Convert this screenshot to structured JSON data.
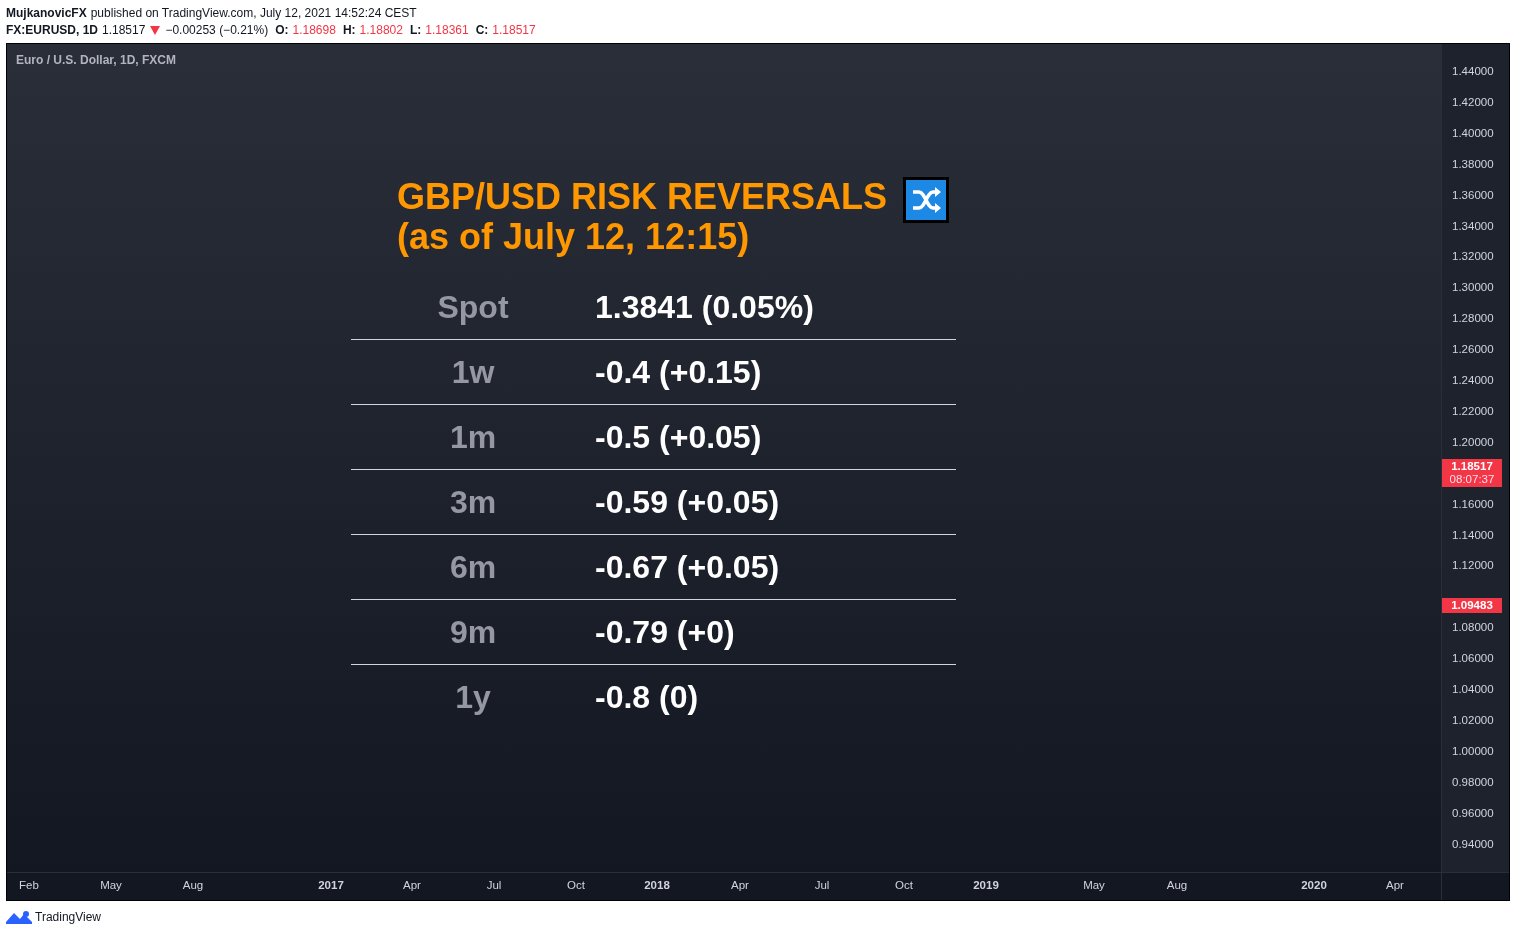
{
  "header": {
    "author": "MujkanovicFX",
    "published": "published on TradingView.com, July 12, 2021 14:52:24 CEST",
    "symbol": "FX:EURUSD, 1D",
    "last": "1.18517",
    "falling": true,
    "change": "−0.00253 (−0.21%)",
    "ohlc": [
      {
        "key": "O:",
        "value": "1.18698"
      },
      {
        "key": "H:",
        "value": "1.18802"
      },
      {
        "key": "L:",
        "value": "1.18361"
      },
      {
        "key": "C:",
        "value": "1.18517"
      }
    ]
  },
  "chart": {
    "legend": "Euro / U.S. Dollar, 1D, FXCM",
    "title_line_1": "GBP/USD RISK REVERSALS",
    "title_line_2": "(as of July 12, 12:15)",
    "rows": [
      {
        "tenor": "Spot",
        "value": "1.3841 (0.05%)"
      },
      {
        "tenor": "1w",
        "value": "-0.4 (+0.15)"
      },
      {
        "tenor": "1m",
        "value": "-0.5 (+0.05)"
      },
      {
        "tenor": "3m",
        "value": "-0.59 (+0.05)"
      },
      {
        "tenor": "6m",
        "value": "-0.67 (+0.05)"
      },
      {
        "tenor": "9m",
        "value": "-0.79 (+0)"
      },
      {
        "tenor": "1y",
        "value": "-0.8 (0)"
      }
    ],
    "price_ticks": [
      "1.44000",
      "1.42000",
      "1.40000",
      "1.38000",
      "1.36000",
      "1.34000",
      "1.32000",
      "1.30000",
      "1.28000",
      "1.26000",
      "1.24000",
      "1.22000",
      "1.20000",
      "1.16000",
      "1.14000",
      "1.12000",
      "1.08000",
      "1.06000",
      "1.04000",
      "1.02000",
      "1.00000",
      "0.98000",
      "0.96000",
      "0.94000"
    ],
    "price_badges": [
      {
        "price": "1.18517",
        "countdown": "08:07:37"
      },
      {
        "price": "1.09483"
      }
    ],
    "time_ticks": [
      {
        "label": "Feb",
        "kind": "month"
      },
      {
        "label": "May",
        "kind": "month"
      },
      {
        "label": "Aug",
        "kind": "month"
      },
      {
        "label": "2017",
        "kind": "year"
      },
      {
        "label": "Apr",
        "kind": "month"
      },
      {
        "label": "Jul",
        "kind": "month"
      },
      {
        "label": "Oct",
        "kind": "month"
      },
      {
        "label": "2018",
        "kind": "year"
      },
      {
        "label": "Apr",
        "kind": "month"
      },
      {
        "label": "Jul",
        "kind": "month"
      },
      {
        "label": "Oct",
        "kind": "month"
      },
      {
        "label": "2019",
        "kind": "year"
      },
      {
        "label": "May",
        "kind": "month"
      },
      {
        "label": "Aug",
        "kind": "month"
      },
      {
        "label": "2020",
        "kind": "year"
      },
      {
        "label": "Apr",
        "kind": "month"
      }
    ]
  },
  "footer": {
    "brand": "TradingView"
  }
}
